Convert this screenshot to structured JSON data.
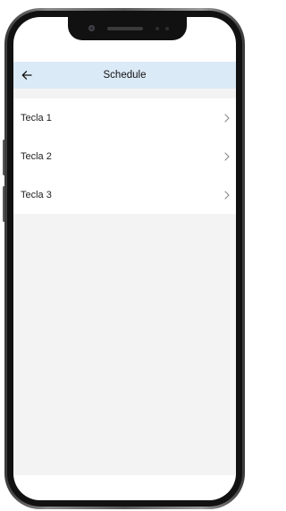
{
  "header": {
    "title": "Schedule",
    "back_icon": "arrow-left-icon"
  },
  "items": [
    {
      "label": "Tecla 1",
      "icon": "chevron-right-icon"
    },
    {
      "label": "Tecla 2",
      "icon": "chevron-right-icon"
    },
    {
      "label": "Tecla 3",
      "icon": "chevron-right-icon"
    }
  ],
  "colors": {
    "header_bg": "#dbeaf7",
    "page_bg": "#f3f3f3",
    "list_bg": "#ffffff"
  }
}
